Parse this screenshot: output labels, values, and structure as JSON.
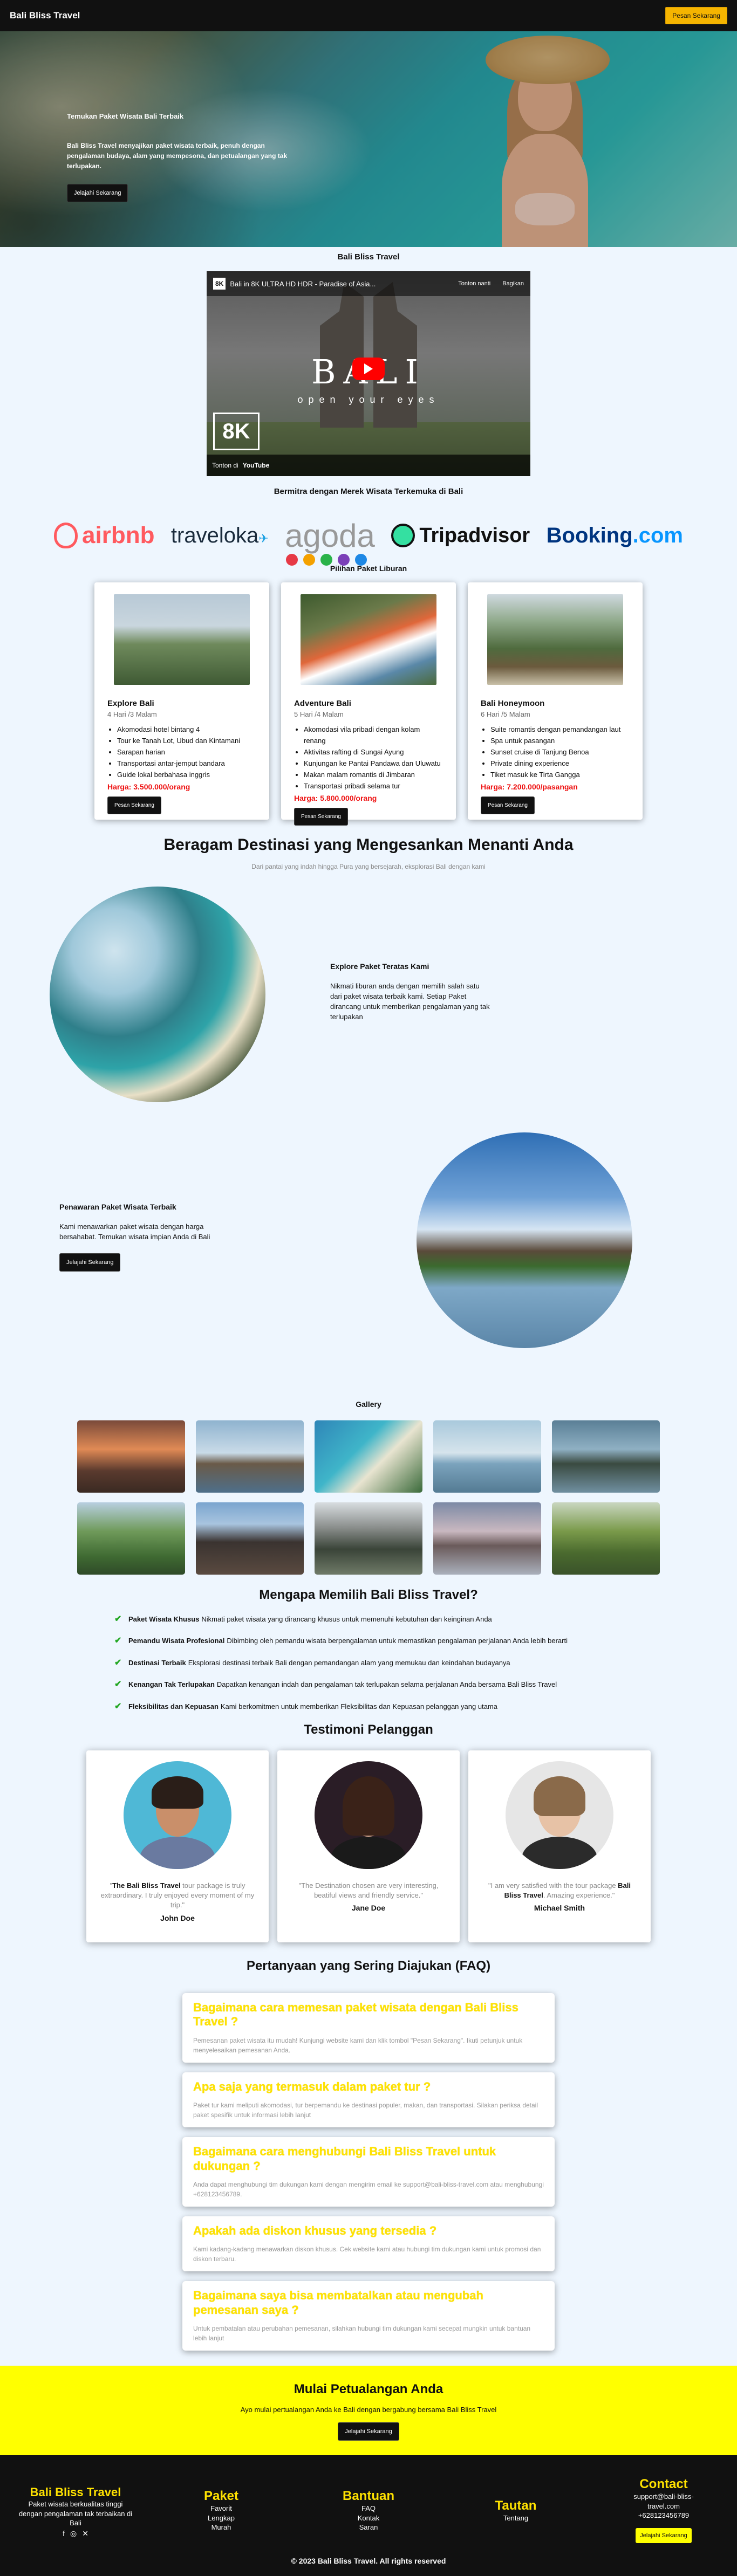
{
  "nav": {
    "brand": "Bali Bliss Travel",
    "cta": "Pesan Sekarang"
  },
  "hero": {
    "tagline": "Temukan Paket Wisata Bali Terbaik",
    "desc": "Bali Bliss Travel menyajikan paket wisata terbaik, penuh dengan pengalaman budaya, alam yang mempesona, dan petualangan yang tak terlupakan.",
    "button": "Jelajahi Sekarang"
  },
  "video": {
    "section_title": "Bali Bliss Travel",
    "badge": "8K",
    "title": "Bali in 8K ULTRA HD HDR - Paradise of Asia...",
    "watch_later": "Tonton nanti",
    "share": "Bagikan",
    "big_title": "BALI",
    "subtitle": "open your eyes",
    "corner": "8K",
    "watch_on": "Tonton di",
    "youtube": "YouTube"
  },
  "partners": {
    "title": "Bermitra dengan Merek Wisata Terkemuka di Bali",
    "airbnb": "airbnb",
    "traveloka": "traveloka",
    "agoda": "agoda",
    "tripadvisor": "Tripadvisor",
    "booking": "Booking",
    "booking_com": ".com"
  },
  "packages": {
    "title": "Pilihan Paket Liburan",
    "items": [
      {
        "name": "Explore Bali",
        "duration": "4 Hari /3 Malam",
        "features": [
          "Akomodasi hotel bintang 4",
          "Tour ke Tanah Lot, Ubud dan Kintamani",
          "Sarapan harian",
          "Transportasi antar-jemput bandara",
          "Guide lokal berbahasa inggris"
        ],
        "price": "Harga: 3.500.000/orang",
        "button": "Pesan Sekarang"
      },
      {
        "name": "Adventure Bali",
        "duration": "5 Hari /4 Malam",
        "features": [
          "Akomodasi vila pribadi dengan kolam renang",
          "Aktivitas rafting di Sungai Ayung",
          "Kunjungan ke Pantai Pandawa dan Uluwatu",
          "Makan malam romantis di Jimbaran",
          "Transportasi pribadi selama tur"
        ],
        "price": "Harga: 5.800.000/orang",
        "button": "Pesan Sekarang"
      },
      {
        "name": "Bali Honeymoon",
        "duration": "6 Hari /5 Malam",
        "features": [
          "Suite romantis dengan pemandangan laut",
          "Spa untuk pasangan",
          "Sunset cruise di Tanjung Benoa",
          "Private dining experience",
          "Tiket masuk ke Tirta Gangga"
        ],
        "price": "Harga: 7.200.000/pasangan",
        "button": "Pesan Sekarang"
      }
    ]
  },
  "destinations": {
    "title": "Beragam Destinasi yang Mengesankan Menanti Anda",
    "subtitle": "Dari pantai yang indah hingga Pura yang bersejarah, eksplorasi Bali dengan kami",
    "feature1": {
      "heading": "Explore Paket Teratas Kami",
      "text": "Nikmati liburan anda dengan memilih salah satu dari paket wisata terbaik kami. Setiap Paket dirancang untuk memberikan pengalaman yang tak terlupakan"
    },
    "feature2": {
      "heading": "Penawaran Paket Wisata Terbaik",
      "text": "Kami menawarkan paket wisata dengan harga bersahabat. Temukan wisata impian Anda di Bali",
      "button": "Jelajahi Sekarang"
    }
  },
  "gallery": {
    "title": "Gallery"
  },
  "why": {
    "title": "Mengapa Memilih Bali Bliss Travel?",
    "items": [
      {
        "label": "Paket Wisata Khusus",
        "text": "Nikmati paket wisata yang dirancang khusus untuk memenuhi kebutuhan dan keinginan Anda"
      },
      {
        "label": "Pemandu Wisata Profesional",
        "text": "Dibimbing oleh pemandu wisata berpengalaman untuk memastikan pengalaman perjalanan Anda lebih berarti"
      },
      {
        "label": "Destinasi Terbaik",
        "text": "Eksplorasi destinasi terbaik Bali dengan pemandangan alam yang memukau dan keindahan budayanya"
      },
      {
        "label": "Kenangan Tak Terlupakan",
        "text": "Dapatkan kenangan indah dan pengalaman tak terlupakan selama perjalanan Anda bersama Bali Bliss Travel"
      },
      {
        "label": "Fleksibilitas dan Kepuasan",
        "text": "Kami berkomitmen untuk memberikan Fleksibilitas dan Kepuasan pelanggan yang utama"
      }
    ]
  },
  "testimonials": {
    "title": "Testimoni Pelanggan",
    "items": [
      {
        "pre": "\"",
        "bold": "The Bali Bliss Travel",
        "text": " tour package is truly extraordinary. I truly enjoyed every moment of my trip.\"",
        "name": "John Doe"
      },
      {
        "pre": "",
        "bold": "",
        "text": "\"The Destination chosen are very interesting, beatiful views and friendly service.\"",
        "name": "Jane Doe"
      },
      {
        "pre": "\"I am very satisfied with the tour package ",
        "bold": "Bali Bliss Travel",
        "text": ". Amazing experience.\"",
        "name": "Michael Smith"
      }
    ]
  },
  "faq": {
    "title": "Pertanyaan yang Sering Diajukan (FAQ)",
    "items": [
      {
        "q": "Bagaimana cara memesan paket wisata dengan Bali Bliss Travel ?",
        "a": "Pemesanan paket wisata itu mudah! Kunjungi website kami dan klik tombol \"Pesan Sekarang\". Ikuti petunjuk untuk menyelesaikan pemesanan Anda."
      },
      {
        "q": "Apa saja yang termasuk dalam paket tur ?",
        "a": "Paket tur kami meliputi akomodasi, tur berpemandu ke destinasi populer, makan, dan transportasi. Silakan periksa detail paket spesifik untuk informasi lebih lanjut"
      },
      {
        "q": "Bagaimana cara menghubungi Bali Bliss Travel untuk dukungan ?",
        "a": "Anda dapat menghubungi tim dukungan kami dengan mengirim email ke support@bali-bliss-travel.com atau menghubungi +628123456789."
      },
      {
        "q": "Apakah ada diskon khusus yang tersedia ?",
        "a": "Kami kadang-kadang menawarkan diskon khusus. Cek website kami atau hubungi tim dukungan kami untuk promosi dan diskon terbaru."
      },
      {
        "q": "Bagaimana saya bisa membatalkan atau mengubah pemesanan saya ?",
        "a": "Untuk pembatalan atau perubahan pemesanan, silahkan hubungi tim dukungan kami secepat mungkin untuk bantuan lebih lanjut"
      }
    ]
  },
  "cta": {
    "title": "Mulai Petualangan Anda",
    "text": "Ayo mulai pertualangan Anda ke Bali dengan bergabung bersama Bali Bliss Travel",
    "button": "Jelajahi Sekarang"
  },
  "footer": {
    "brand": "Bali Bliss Travel",
    "brand_text": "Paket wisata berkualitas tinggi dengan pengalaman tak terbaikan di Bali",
    "paket_title": "Paket",
    "paket_links": [
      "Favorit",
      "Lengkap",
      "Murah"
    ],
    "bantuan_title": "Bantuan",
    "bantuan_links": [
      "FAQ",
      "Kontak",
      "Saran"
    ],
    "tautan_title": "Tautan",
    "tautan_links": [
      "Tentang"
    ],
    "contact_title": "Contact",
    "email": "support@bali-bliss-travel.com",
    "phone": "+628123456789",
    "button": "Jelajahi Sekarang",
    "copyright": "© 2023 Bali Bliss Travel. All rights reserved"
  }
}
